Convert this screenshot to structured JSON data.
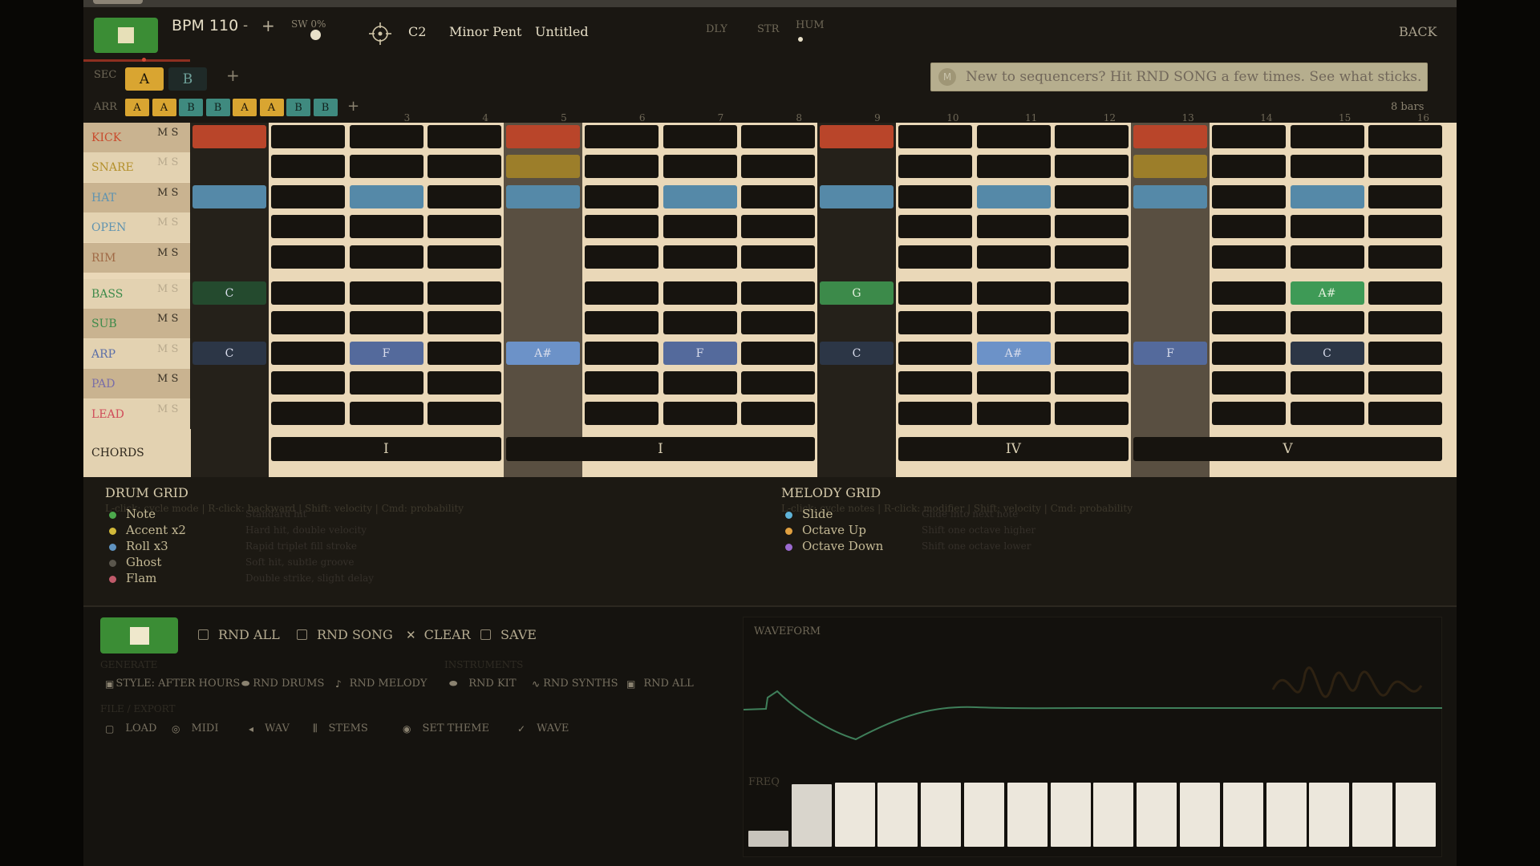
{
  "header": {
    "bpm": "BPM 110",
    "bpm_minus": "-",
    "bpm_plus": "+",
    "swing": "SW 0%",
    "key": "C2",
    "scale": "Minor Pent",
    "song_name": "Untitled",
    "fx": [
      "DLY",
      "STR",
      "HUM"
    ],
    "back": "BACK"
  },
  "sections": {
    "label": "SEC",
    "items": [
      "A",
      "B"
    ],
    "add": "+"
  },
  "arrangement": {
    "label": "ARR",
    "items": [
      "A",
      "A",
      "B",
      "B",
      "A",
      "A",
      "B",
      "B"
    ],
    "add": "+"
  },
  "tip": {
    "icon": "M",
    "text": "New to sequencers? Hit RND SONG a few times. See what sticks."
  },
  "bars_label": "8 bars",
  "column_numbers": [
    "",
    "",
    "3",
    "4",
    "5",
    "6",
    "7",
    "8",
    "9",
    "10",
    "11",
    "12",
    "13",
    "14",
    "15",
    "16"
  ],
  "lanes": [
    {
      "name": "KICK",
      "ms": "M S",
      "color": "#c94a2c"
    },
    {
      "name": "SNARE",
      "ms": "M S",
      "color": "#b4902c"
    },
    {
      "name": "HAT",
      "ms": "M S",
      "color": "#5f93b0"
    },
    {
      "name": "OPEN",
      "ms": "M S",
      "color": "#5f93b0"
    },
    {
      "name": "RIM",
      "ms": "M S",
      "color": "#a06a46"
    },
    {
      "name": "BASS",
      "ms": "M S",
      "color": "#3c8a4a"
    },
    {
      "name": "SUB",
      "ms": "M S",
      "color": "#3c8a4a"
    },
    {
      "name": "ARP",
      "ms": "M S",
      "color": "#5b6fa8"
    },
    {
      "name": "PAD",
      "ms": "M S",
      "color": "#7a6ea8"
    },
    {
      "name": "LEAD",
      "ms": "M S",
      "color": "#d04c5a"
    }
  ],
  "melody_notes": [
    {
      "lane": 5,
      "col": 0,
      "note": "C"
    },
    {
      "lane": 5,
      "col": 8,
      "note": "G"
    },
    {
      "lane": 5,
      "col": 14,
      "note": "A#"
    },
    {
      "lane": 7,
      "col": 0,
      "note": "C"
    },
    {
      "lane": 7,
      "col": 2,
      "note": "F"
    },
    {
      "lane": 7,
      "col": 4,
      "note": "A#"
    },
    {
      "lane": 7,
      "col": 6,
      "note": "F"
    },
    {
      "lane": 7,
      "col": 8,
      "note": "C"
    },
    {
      "lane": 7,
      "col": 10,
      "note": "A#"
    },
    {
      "lane": 7,
      "col": 12,
      "note": "F"
    },
    {
      "lane": 7,
      "col": 14,
      "note": "C"
    }
  ],
  "chords": {
    "label": "CHORDS",
    "items": [
      {
        "label": "I",
        "start": 1,
        "span": 3
      },
      {
        "label": "I",
        "start": 4,
        "span": 4
      },
      {
        "label": "IV",
        "start": 9,
        "span": 3
      },
      {
        "label": "V",
        "start": 12,
        "span": 4
      }
    ]
  },
  "drum_legend": {
    "title": "DRUM GRID",
    "hint": "L-click: cycle mode  |  R-click: backward  |  Shift: velocity  |  Cmd: probability",
    "items": [
      {
        "label": "Note",
        "desc": "Standard hit",
        "color": "#4caa4c"
      },
      {
        "label": "Accent x2",
        "desc": "Hard hit, double velocity",
        "color": "#d2b93a"
      },
      {
        "label": "Roll x3",
        "desc": "Rapid triplet fill stroke",
        "color": "#5f93c0"
      },
      {
        "label": "Ghost",
        "desc": "Soft hit, subtle groove",
        "color": "#5a564c"
      },
      {
        "label": "Flam",
        "desc": "Double strike, slight delay",
        "color": "#c05a6a"
      }
    ]
  },
  "melody_legend": {
    "title": "MELODY GRID",
    "hint": "L-click: cycle notes  |  R-click: modifier  |  Shift: velocity  |  Cmd: probability",
    "items": [
      {
        "label": "Slide",
        "desc": "Glide into next note",
        "color": "#5fb3d8"
      },
      {
        "label": "Octave Up",
        "desc": "Shift one octave higher",
        "color": "#e0a040"
      },
      {
        "label": "Octave Down",
        "desc": "Shift one octave lower",
        "color": "#9b6ad0"
      }
    ]
  },
  "toolbar": {
    "rnd_all": "RND ALL",
    "rnd_song": "RND SONG",
    "clear": "CLEAR",
    "save": "SAVE"
  },
  "generate": {
    "caption": "GENERATE",
    "style": "STYLE: AFTER HOURS",
    "rnd_drums": "RND DRUMS",
    "rnd_melody": "RND MELODY"
  },
  "instruments": {
    "caption": "INSTRUMENTS",
    "rnd_kit": "RND KIT",
    "rnd_synths": "RND SYNTHS",
    "rnd_all": "RND ALL"
  },
  "file_export": {
    "caption": "FILE / EXPORT",
    "load": "LOAD",
    "midi": "MIDI",
    "wav": "WAV",
    "stems": "STEMS",
    "set_theme": "SET THEME",
    "wave": "WAVE"
  },
  "waveform": {
    "label": "WAVEFORM",
    "freq_label": "FREQ",
    "freq_levels": [
      0.25,
      0.97,
      1,
      1,
      1,
      1,
      1,
      1,
      1,
      1,
      1,
      1,
      1,
      1,
      1,
      1
    ]
  },
  "colors": {
    "accent_green": "#3b8d35",
    "section_a": "#d9a531",
    "section_b": "#3f8a7f",
    "grid_bg": "#ead8b8",
    "cell_bg": "#17140f"
  }
}
